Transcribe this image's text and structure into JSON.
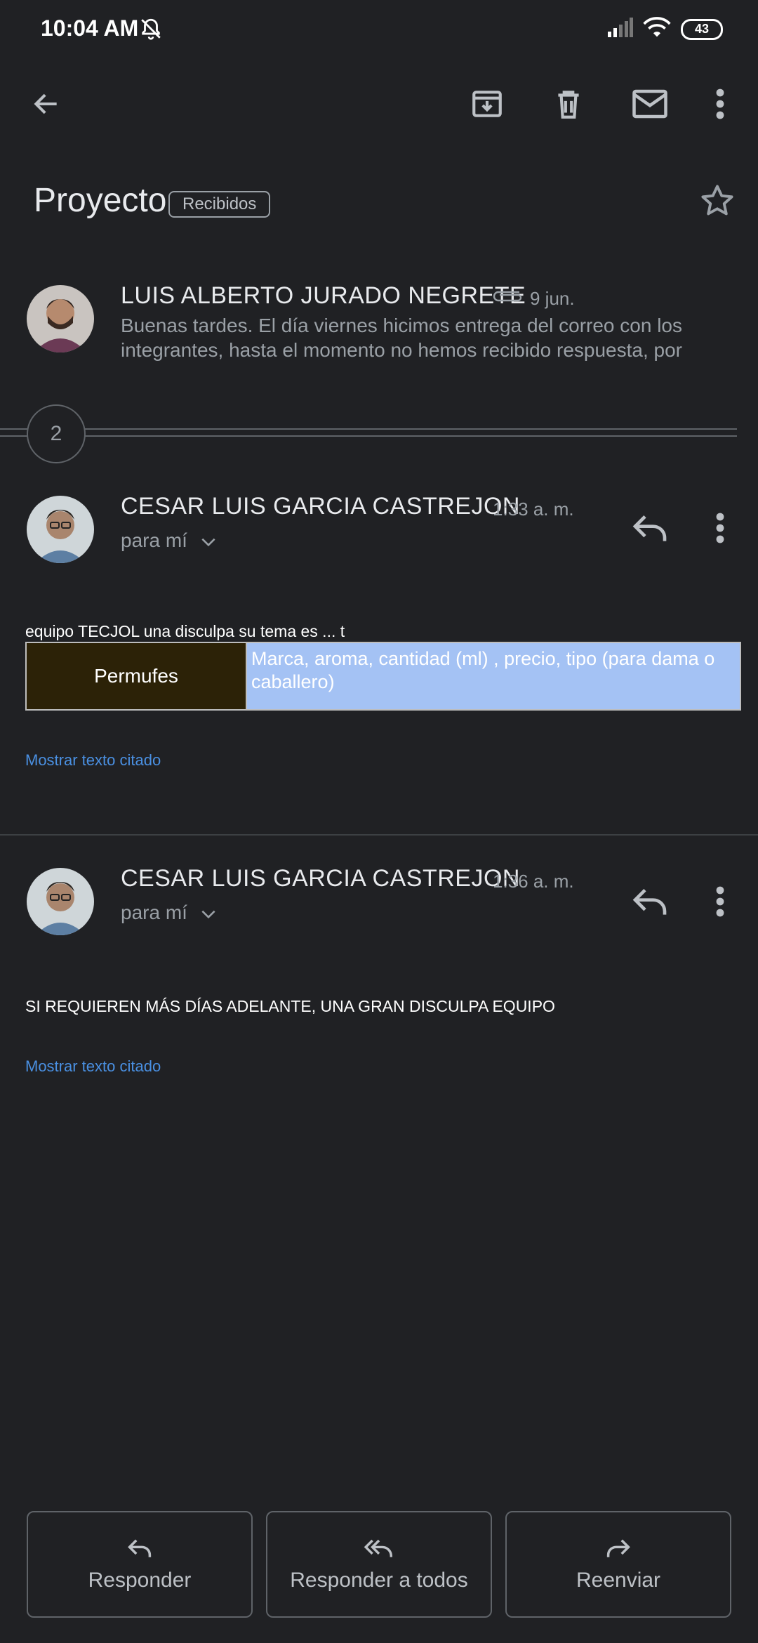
{
  "status_bar": {
    "time": "10:04 AM",
    "battery": "43"
  },
  "email": {
    "subject": "Proyecto",
    "label": "Recibidos",
    "collapsed_message": {
      "sender": "LUIS ALBERTO JURADO NEGRETE",
      "date": "9 jun.",
      "snippet": "Buenas tardes. El día viernes hicimos entrega del correo con los integrantes, hasta el momento no hemos recibido respuesta, por"
    },
    "hidden_count": "2",
    "messages": [
      {
        "sender": "CESAR LUIS GARCIA CASTREJON",
        "time": "1:33 a. m.",
        "recipient": "para mí",
        "body": "equipo TECJOL una disculpa su tema es ... t",
        "table": {
          "left": "Permufes",
          "right": "Marca, aroma, cantidad (ml) , precio, tipo (para dama o caballero)"
        },
        "quoted_link": "Mostrar texto citado"
      },
      {
        "sender": "CESAR LUIS GARCIA CASTREJON",
        "time": "1:36 a. m.",
        "recipient": "para mí",
        "body": "SI REQUIEREN MÁS DÍAS ADELANTE, UNA GRAN DISCULPA EQUIPO",
        "quoted_link": "Mostrar texto citado"
      }
    ]
  },
  "actions": {
    "reply": "Responder",
    "reply_all": "Responder a todos",
    "forward": "Reenviar"
  },
  "colors": {
    "background": "#202124",
    "link": "#4a90e2",
    "table_dark": "#2c2207",
    "table_light": "#a4c2f4"
  }
}
